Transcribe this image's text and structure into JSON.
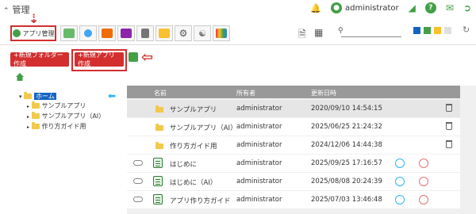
{
  "header": {
    "title": "管理",
    "user": "administrator"
  },
  "toolbar": {
    "app_manage_tab": "アプリ管理",
    "search_placeholder": "",
    "color_swatches": [
      "#1565c0",
      "#43a047",
      "#fbc02d",
      "#e0e0e0"
    ]
  },
  "buttons": {
    "new_folder": "+新規フォルダー作成",
    "new_app": "+新規アプリ作成"
  },
  "tree": {
    "root": "ホーム",
    "children": [
      "サンプルアプリ",
      "サンプルアプリ（AI）",
      "作り方ガイド用"
    ]
  },
  "list": {
    "columns": {
      "name": "名前",
      "owner": "所有者",
      "updated": "更新日時"
    },
    "rows": [
      {
        "type": "folder",
        "name": "サンプルアプリ",
        "owner": "administrator",
        "updated": "2020/09/10 14:54:15"
      },
      {
        "type": "folder",
        "name": "サンプルアプリ（AI）",
        "owner": "administrator",
        "updated": "2025/06/25 21:24:32"
      },
      {
        "type": "folder",
        "name": "作り方ガイド用",
        "owner": "administrator",
        "updated": "2024/12/06 14:44:38"
      },
      {
        "type": "app",
        "name": "はじめに",
        "owner": "administrator",
        "updated": "2025/09/25 17:16:57"
      },
      {
        "type": "app",
        "name": "はじめに（AI）",
        "owner": "administrator",
        "updated": "2025/08/08 20:24:39"
      },
      {
        "type": "app",
        "name": "アプリ作り方ガイド",
        "owner": "administrator",
        "updated": "2025/07/03 13:46:48"
      }
    ]
  }
}
